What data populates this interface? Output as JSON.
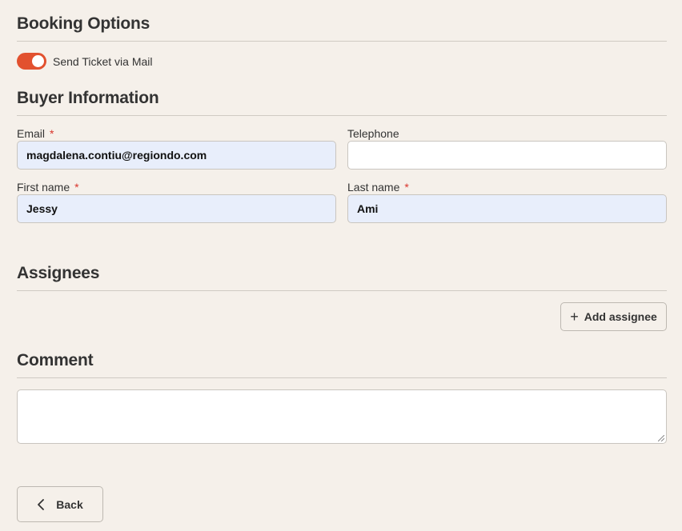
{
  "booking_options": {
    "title": "Booking Options",
    "toggle_label": "Send Ticket via Mail",
    "toggle_on": true
  },
  "buyer_information": {
    "title": "Buyer Information",
    "required_mark": "*",
    "email": {
      "label": "Email",
      "value": "magdalena.contiu@regiondo.com",
      "required": true
    },
    "telephone": {
      "label": "Telephone",
      "value": "",
      "required": false
    },
    "first_name": {
      "label": "First name",
      "value": "Jessy",
      "required": true
    },
    "last_name": {
      "label": "Last name",
      "value": "Ami",
      "required": true
    }
  },
  "assignees": {
    "title": "Assignees",
    "add_label": "Add assignee"
  },
  "comment": {
    "title": "Comment",
    "value": ""
  },
  "footer": {
    "back_label": "Back"
  },
  "colors": {
    "accent": "#e2512f",
    "required": "#d9342b",
    "filled_input": "#e8eefb",
    "background": "#f5f0ea"
  }
}
